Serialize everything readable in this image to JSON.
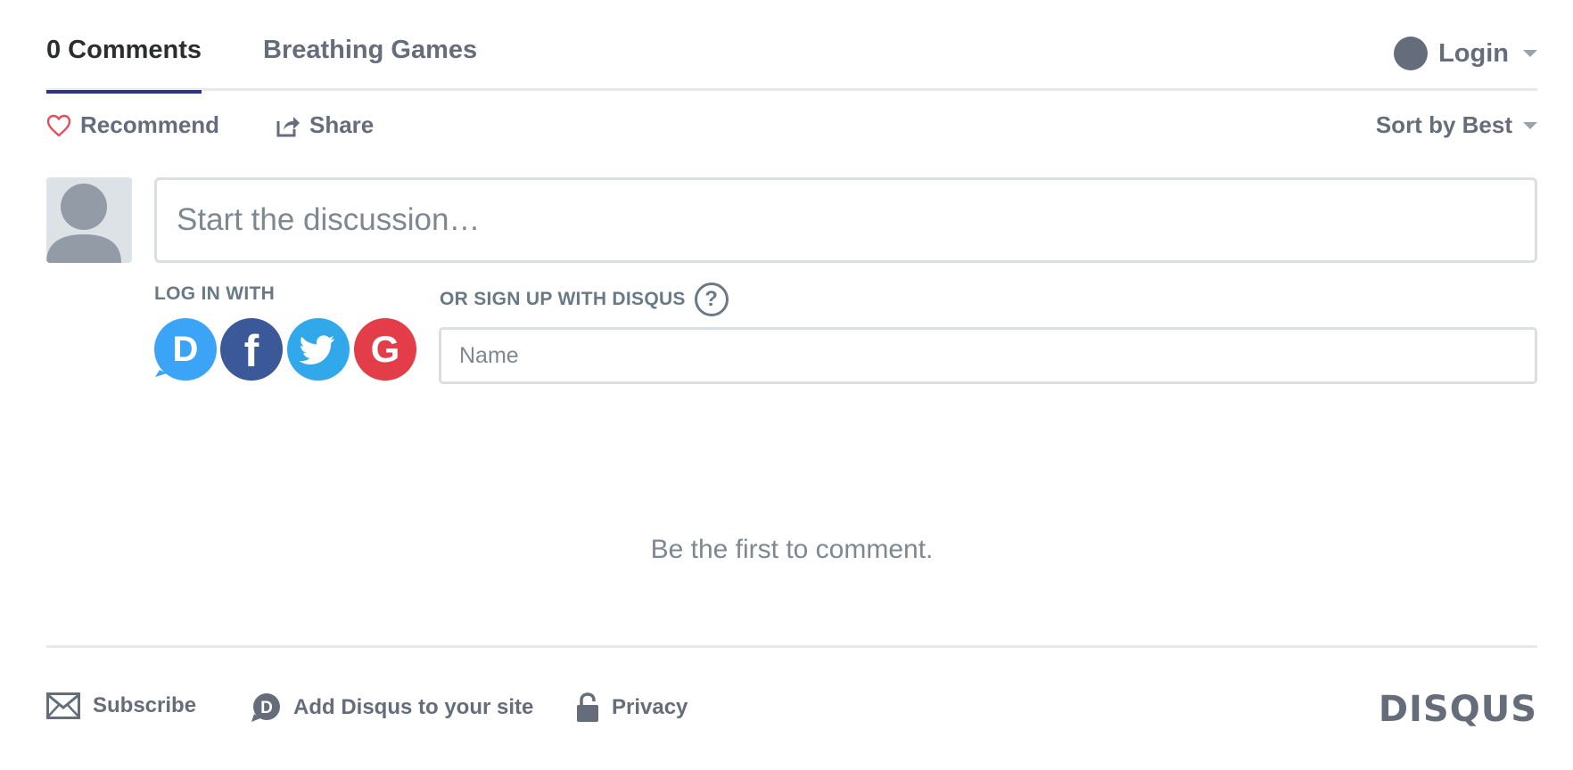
{
  "nav": {
    "comments_tab": "0 Comments",
    "forum_tab": "Breathing Games",
    "login_label": "Login"
  },
  "actions": {
    "recommend_label": "Recommend",
    "share_label": "Share",
    "sort_label": "Sort by Best"
  },
  "composer": {
    "placeholder": "Start the discussion…",
    "login_with_label": "LOG IN WITH",
    "signup_label": "OR SIGN UP WITH DISQUS",
    "help_glyph": "?",
    "name_placeholder": "Name",
    "social_providers": [
      {
        "name": "Disqus",
        "glyph": "D",
        "color": "#3ca4f7"
      },
      {
        "name": "Facebook",
        "glyph": "f",
        "color": "#3b5999"
      },
      {
        "name": "Twitter",
        "glyph": "twitter-bird",
        "color": "#31a8ea"
      },
      {
        "name": "Google",
        "glyph": "G",
        "color": "#e23d49"
      }
    ]
  },
  "empty_state": "Be the first to comment.",
  "footer": {
    "subscribe_label": "Subscribe",
    "add_disqus_label": "Add Disqus to your site",
    "privacy_label": "Privacy",
    "brand": "DISQUS"
  },
  "colors": {
    "accent_underline": "#2e3192",
    "heart": "#e1505b",
    "text_muted": "#656c7a",
    "border": "#dbdfe4"
  },
  "icons": [
    "user-icon",
    "heart-icon",
    "share-icon",
    "caret-down-icon",
    "help-icon",
    "mail-icon",
    "disqus-logo-icon",
    "lock-icon"
  ]
}
